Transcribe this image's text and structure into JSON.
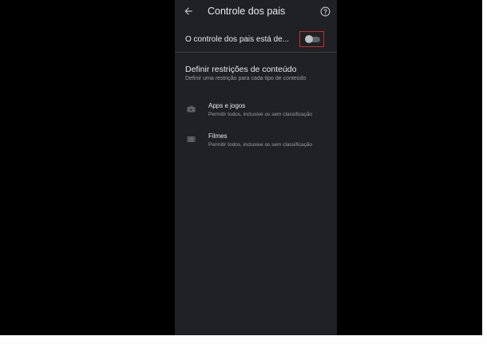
{
  "app_bar": {
    "title": "Controle dos pais",
    "back_icon": "arrow-back-icon",
    "help_icon": "help-circle-icon"
  },
  "parental_toggle": {
    "label": "O controle dos pais está de...",
    "state": "off",
    "highlight_color": "#d3232f"
  },
  "restrictions": {
    "title": "Definir restrições de conteúdo",
    "subtitle": "Definir uma restrição para cada tipo de conteúdo",
    "items": [
      {
        "icon": "apps-store-icon",
        "title": "Apps e jogos",
        "subtitle": "Permitir todos, inclusive os sem classificação"
      },
      {
        "icon": "movie-icon",
        "title": "Filmes",
        "subtitle": "Permitir todos, inclusive os sem classificação"
      }
    ]
  },
  "colors": {
    "background": "#202124",
    "text_primary": "#e8eaed",
    "text_secondary": "#9aa0a6"
  }
}
